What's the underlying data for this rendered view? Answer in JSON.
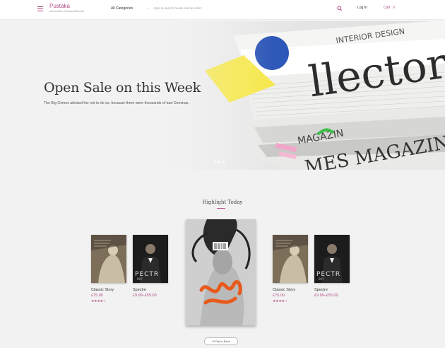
{
  "header": {
    "brand": "Pustaka",
    "tagline": "Just another Pustaka Sites site",
    "category_label": "All Categories",
    "search_placeholder": "Type to search books and hit enter",
    "login_label": "Log In",
    "cart_label": "Cart",
    "cart_count": "0"
  },
  "hero": {
    "title": "Open Sale on this Week",
    "subtitle": "The Big Oxmox advised her not to do so, because there were thousands of bad Commas."
  },
  "highlight": {
    "heading": "Highlight Today",
    "flip_label": "Flip to Back",
    "books": [
      {
        "title": "Classic Story",
        "price": "£75.00",
        "rating": 4
      },
      {
        "title": "Spectre",
        "price": "£9.99–£55.00",
        "rating": 0
      },
      {
        "title": "Classic Story",
        "price": "£75.00",
        "rating": 4
      },
      {
        "title": "Spectre",
        "price": "£9.99–£55.00",
        "rating": 0
      }
    ]
  },
  "colors": {
    "accent": "#b04a85",
    "background": "#f3f2f2"
  }
}
